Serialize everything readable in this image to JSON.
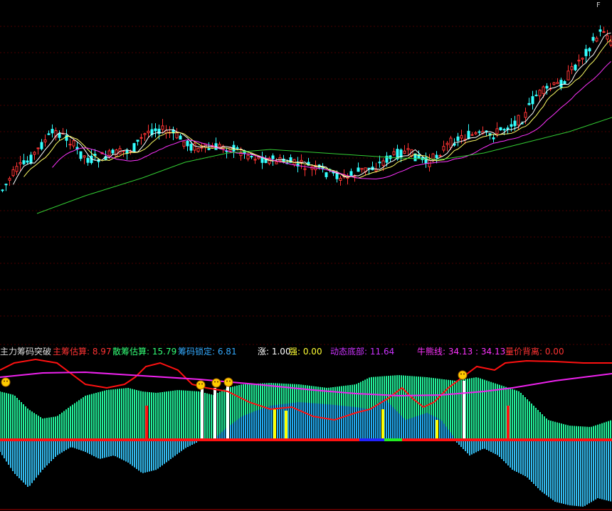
{
  "indicator": {
    "name": "主力筹码突破",
    "labels": [
      {
        "key": "main",
        "text": "主筹估算: 8.97",
        "color": "#ff3333"
      },
      {
        "key": "retail",
        "text": "散筹估算: 15.79",
        "color": "#33ff77"
      },
      {
        "key": "lock",
        "text": "筹码锁定: 6.81",
        "color": "#33aaff"
      },
      {
        "key": "zhang",
        "text": "涨: 1.00",
        "color": "#ffffff"
      },
      {
        "key": "qiang",
        "text": "强: 0.00",
        "color": "#ffff33"
      },
      {
        "key": "bottom",
        "text": "动态底部: 11.64",
        "color": "#cc33ff"
      },
      {
        "key": "bull",
        "text": "牛熊线: 34.13 : 34.13",
        "color": "#ff33ff"
      },
      {
        "key": "diverg",
        "text": "量价背离: 0.00",
        "color": "#ff3333"
      }
    ],
    "corner": "F"
  },
  "colors": {
    "up": "#ff3333",
    "down": "#33ffff",
    "ma5": "#ffffff",
    "ma10": "#ffff66",
    "ma20": "#ff33ff",
    "ma60": "#33cc33",
    "green": "#22ee99",
    "blue": "#22aaee",
    "red": "#ff1111",
    "magenta": "#ee22ee",
    "yellow": "#ffff00",
    "grid": "#3a0000"
  }
}
